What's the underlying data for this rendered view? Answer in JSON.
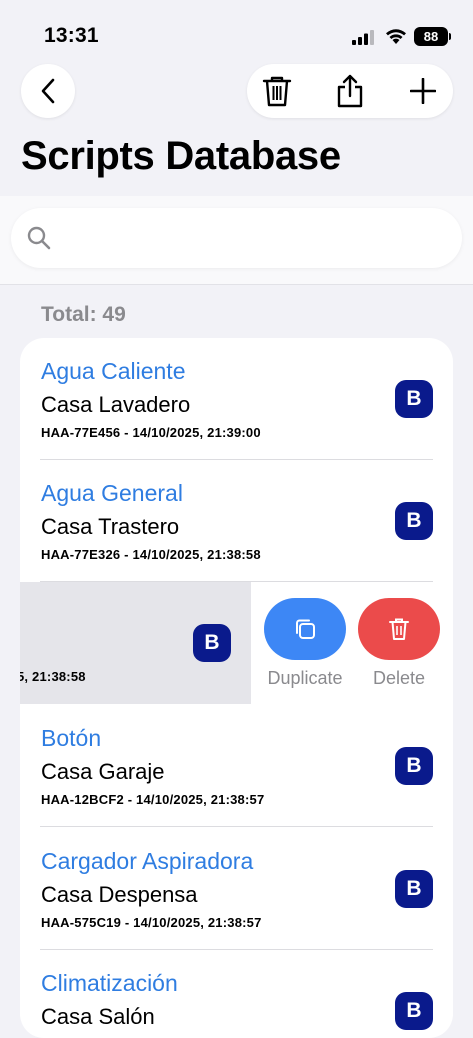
{
  "status_bar": {
    "time": "13:31",
    "battery": "88"
  },
  "toolbar": {
    "back_icon": "chevron-left-icon",
    "delete_icon": "trash-icon",
    "share_icon": "share-icon",
    "add_icon": "plus-icon"
  },
  "page": {
    "title": "Scripts Database"
  },
  "search": {
    "placeholder": "",
    "value": ""
  },
  "list": {
    "total_label": "Total: 49",
    "badge_letter": "B",
    "items": [
      {
        "title": "Agua Caliente",
        "subtitle": "Casa Lavadero",
        "meta": "HAA-77E456 - 14/10/2025, 21:39:00"
      },
      {
        "title": "Agua General",
        "subtitle": "Casa Trastero",
        "meta": "HAA-77E326 - 14/10/2025, 21:38:58"
      },
      {
        "title": "Botón",
        "subtitle": "Casa Garaje",
        "meta": "HAA-12BCF2 - 14/10/2025, 21:38:57"
      },
      {
        "title": "Cargador Aspiradora",
        "subtitle": "Casa Despensa",
        "meta": "HAA-575C19 - 14/10/2025, 21:38:57"
      },
      {
        "title": "Climatización",
        "subtitle": "Casa Salón",
        "meta": ""
      }
    ],
    "swiped_item": {
      "meta_fragment": "5, 21:38:58",
      "duplicate_label": "Duplicate",
      "delete_label": "Delete"
    }
  },
  "colors": {
    "accent": "#2f7de1",
    "badge": "#0a1a8c",
    "duplicate": "#3d87f5",
    "delete": "#eb4b4b"
  }
}
